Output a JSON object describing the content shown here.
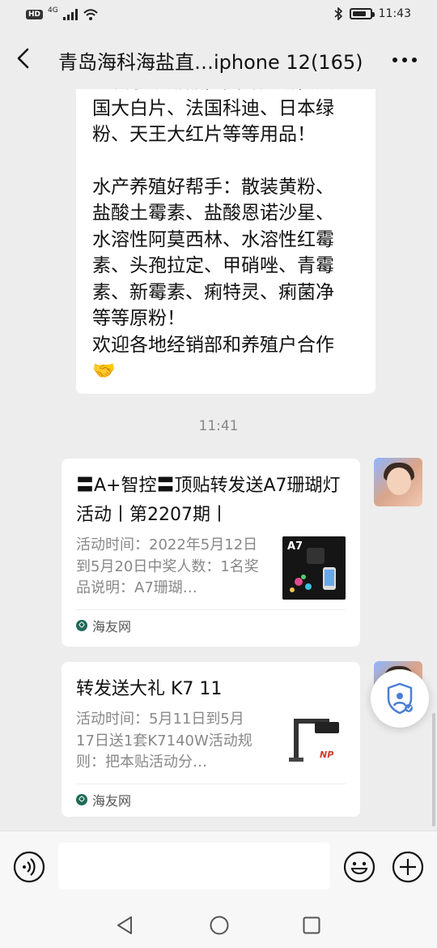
{
  "status_bar": {
    "network": "4G",
    "hd_label": "HD",
    "time": "11:43",
    "battery_level": 0.8
  },
  "header": {
    "title": "青岛海科海盐直…iphone 12(165)",
    "back_icon": "chevron-left-icon",
    "more_icon": "more-dots-icon"
  },
  "messages": {
    "text_bubble": {
      "lines_top": [
        "批发子放用品，图财灭助，美",
        "国大白片、法国科迪、日本绿",
        "粉、天王大红片等等用品！"
      ],
      "paragraph2": [
        "水产养殖好帮手：散装黄粉、",
        "盐酸土霉素、盐酸恩诺沙星、",
        "水溶性阿莫西林、水溶性红霉",
        "素、头孢拉定、甲硝唑、青霉",
        "素、新霉素、痢特灵、痢菌净",
        "等等原粉！",
        "欢迎各地经销部和养殖户合作"
      ],
      "emoji": "🤝"
    },
    "timestamp": "11:41",
    "cards": [
      {
        "title": "〓A+智控〓顶贴转发送A7珊瑚灯活动丨第2207期丨",
        "desc": "活动时间：2022年5月12日到5月20日中奖人数：1名奖品说明：A7珊瑚…",
        "thumb_label": "A7",
        "source": "海友网"
      },
      {
        "title": "转发送大礼 K7 11",
        "desc": "活动时间：5月11日到5月17日送1套K7140W活动规则：把本贴活动分…",
        "thumb_label": "NP",
        "source": "海友网"
      }
    ]
  },
  "input_bar": {
    "placeholder": "",
    "voice_icon": "voice-icon",
    "emoji_icon": "emoji-icon",
    "plus_icon": "plus-icon"
  },
  "system_nav": {
    "back_icon": "triangle-back-icon",
    "home_icon": "circle-home-icon",
    "recent_icon": "square-recent-icon"
  },
  "colors": {
    "background": "#ededed",
    "bubble": "#ffffff",
    "secondary_text": "#888888",
    "accent_shield": "#4a7fd4"
  }
}
